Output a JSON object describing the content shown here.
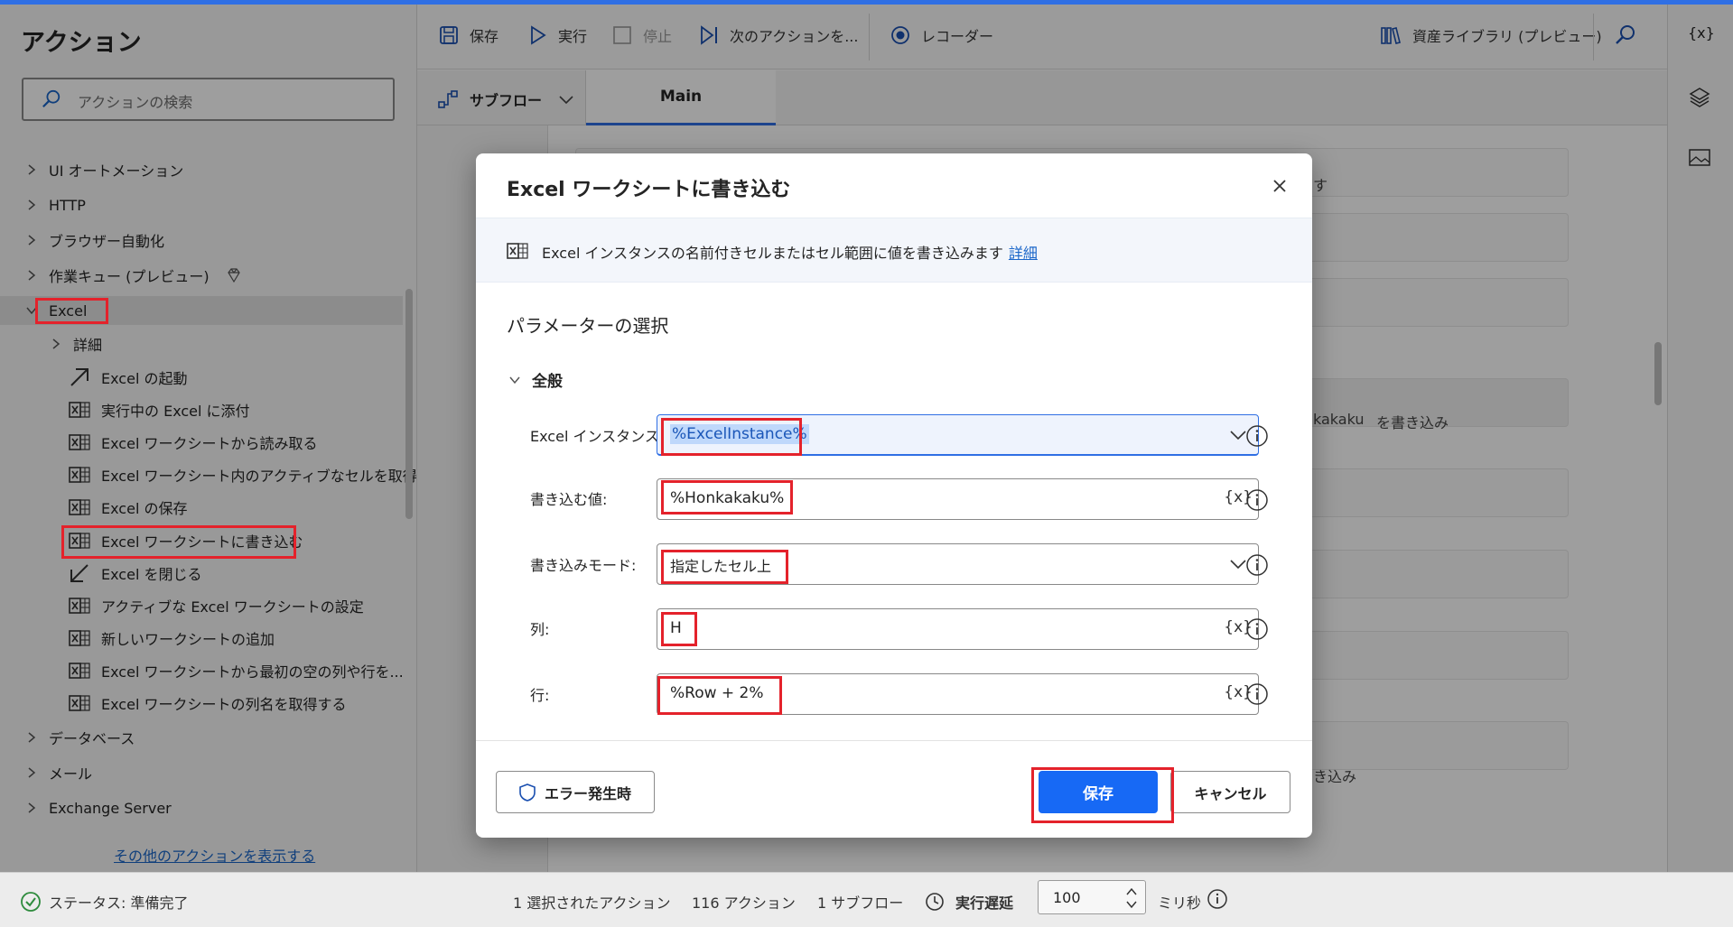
{
  "panel": {
    "title": "アクション",
    "search_placeholder": "アクションの検索",
    "categories": [
      {
        "label": "UI オートメーション"
      },
      {
        "label": "HTTP"
      },
      {
        "label": "ブラウザー自動化"
      },
      {
        "label": "作業キュー (プレビュー)"
      },
      {
        "label": "Excel"
      }
    ],
    "excel_children": [
      {
        "label": "詳細",
        "type": "group"
      },
      {
        "label": "Excel の起動",
        "icon": "arrow-up-right-icon"
      },
      {
        "label": "実行中の Excel に添付",
        "icon": "excel-icon"
      },
      {
        "label": "Excel ワークシートから読み取る",
        "icon": "excel-icon"
      },
      {
        "label": "Excel ワークシート内のアクティブなセルを取得",
        "icon": "excel-icon"
      },
      {
        "label": "Excel の保存",
        "icon": "excel-icon"
      },
      {
        "label": "Excel ワークシートに書き込む",
        "icon": "excel-icon"
      },
      {
        "label": "Excel を閉じる",
        "icon": "arrow-down-left-icon"
      },
      {
        "label": "アクティブな Excel ワークシートの設定",
        "icon": "excel-icon"
      },
      {
        "label": "新しいワークシートの追加",
        "icon": "excel-icon"
      },
      {
        "label": "Excel ワークシートから最初の空の列や行を...",
        "icon": "excel-icon"
      },
      {
        "label": "Excel ワークシートの列名を取得する",
        "icon": "excel-icon"
      }
    ],
    "more_categories": [
      {
        "label": "データベース"
      },
      {
        "label": "メール"
      },
      {
        "label": "Exchange Server"
      }
    ],
    "show_more_link": "その他のアクションを表示する"
  },
  "toolbar": {
    "save": "保存",
    "run": "実行",
    "stop": "停止",
    "next_action": "次のアクションを...",
    "recorder": "レコーダー",
    "asset_library": "資産ライブラリ (プレビュー)"
  },
  "tabs": {
    "subflow": "サブフロー",
    "main": "Main"
  },
  "right_rail": {
    "variables": "{x}"
  },
  "canvas_fragments": {
    "frag1": "す",
    "frag2": "kakaku",
    "frag3": "を書き込み",
    "frag4": "き込み"
  },
  "dialog": {
    "title": "Excel ワークシートに書き込む",
    "description": "Excel インスタンスの名前付きセルまたはセル範囲に値を書き込みます",
    "details_link": "詳細",
    "section_title": "パラメーターの選択",
    "group_title": "全般",
    "fields": {
      "instance": {
        "label": "Excel インスタンス:",
        "value": "%ExcelInstance%"
      },
      "value": {
        "label": "書き込む値:",
        "value": "%Honkakaku%"
      },
      "mode": {
        "label": "書き込みモード:",
        "value": "指定したセル上"
      },
      "column": {
        "label": "列:",
        "value": "H"
      },
      "row": {
        "label": "行:",
        "value": "%Row + 2%"
      }
    },
    "var_button": "{x}",
    "error_button": "エラー発生時",
    "save_button": "保存",
    "cancel_button": "キャンセル"
  },
  "statusbar": {
    "status": "ステータス: 準備完了",
    "selected": "1 選択されたアクション",
    "actions": "116 アクション",
    "subflows": "1 サブフロー",
    "delay_label": "実行遅延",
    "delay_value": "100",
    "delay_unit": "ミリ秒"
  },
  "colors": {
    "accent": "#1769f5",
    "highlight_box": "#e4222b",
    "link": "#1a66c9"
  }
}
